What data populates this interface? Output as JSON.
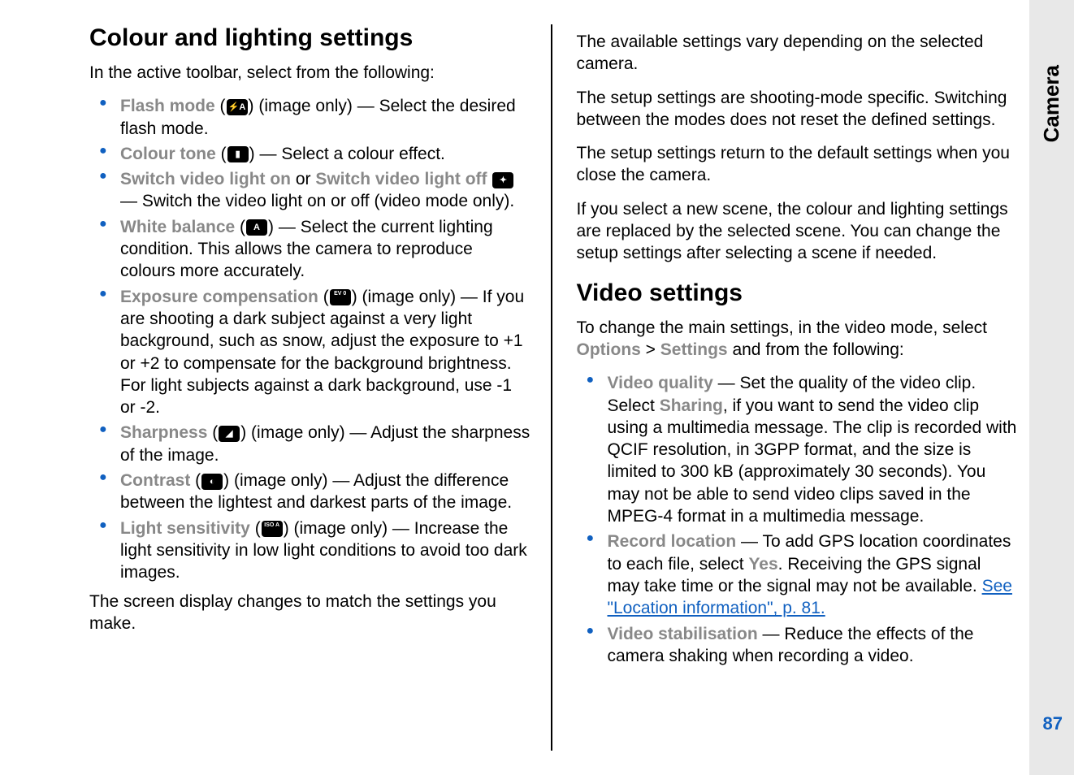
{
  "section_tab": "Camera",
  "page_number": "87",
  "left": {
    "heading": "Colour and lighting settings",
    "intro": "In the active toolbar, select from the following:",
    "items": [
      {
        "label": "Flash mode",
        "icon": "⚡A",
        "tail": " (image only) — Select the desired flash mode."
      },
      {
        "label": "Colour tone",
        "icon": "▮",
        "tail": "  — Select a colour effect."
      },
      {
        "label": "Switch video light on",
        "mid": " or ",
        "label2": "Switch video light off",
        "icon": "✦",
        "tail": " — Switch the video light on or off (video mode only)."
      },
      {
        "label": "White balance",
        "icon": "A",
        "tail": "  — Select the current lighting condition. This allows the camera to reproduce colours more accurately."
      },
      {
        "label": "Exposure compensation",
        "icon": "EV 0",
        "tail": " (image only) — If you are shooting a dark subject against a very light background, such as snow, adjust the exposure to +1 or +2 to compensate for the background brightness. For light subjects against a dark background, use -1 or -2."
      },
      {
        "label": "Sharpness",
        "icon": "◢",
        "tail": " (image only)  — Adjust the sharpness of the image."
      },
      {
        "label": "Contrast",
        "icon": "◐",
        "tail": " (image only)  — Adjust the difference between the lightest and darkest parts of the image."
      },
      {
        "label": "Light sensitivity",
        "icon": "ISO A",
        "tail": " (image only)  — Increase the light sensitivity in low light conditions to avoid too dark images."
      }
    ],
    "outro": "The screen display changes to match the settings you make."
  },
  "right": {
    "p1": "The available settings vary depending on the selected camera.",
    "p2": "The setup settings are shooting-mode specific. Switching between the modes does not reset the defined settings.",
    "p3": "The setup settings return to the default settings when you close the camera.",
    "p4": "If you select a new scene, the colour and lighting settings are replaced by the selected scene. You can change the setup settings after selecting a scene if needed.",
    "heading": "Video settings",
    "intro_a": "To change the main settings, in the video mode, select ",
    "intro_opt": "Options",
    "intro_gt": " > ",
    "intro_set": "Settings",
    "intro_b": " and from the following:",
    "items": [
      {
        "label": "Video quality",
        "tail_a": "  — Set the quality of the video clip. Select ",
        "sharing": "Sharing",
        "tail_b": ", if you want to send the video clip using a multimedia message. The clip is recorded with QCIF resolution, in 3GPP format, and the size is limited to 300 kB (approximately 30 seconds). You may not be able to send video clips saved in the MPEG-4 format in a multimedia message."
      },
      {
        "label": "Record location",
        "tail_a": "  — To add GPS location coordinates to each file, select ",
        "yes": "Yes",
        "tail_b": ". Receiving the GPS signal may take time or the signal may not be available. ",
        "link": "See \"Location information\", p. 81."
      },
      {
        "label": "Video stabilisation",
        "tail_a": "  — Reduce the effects of the camera shaking when recording a video."
      }
    ]
  }
}
